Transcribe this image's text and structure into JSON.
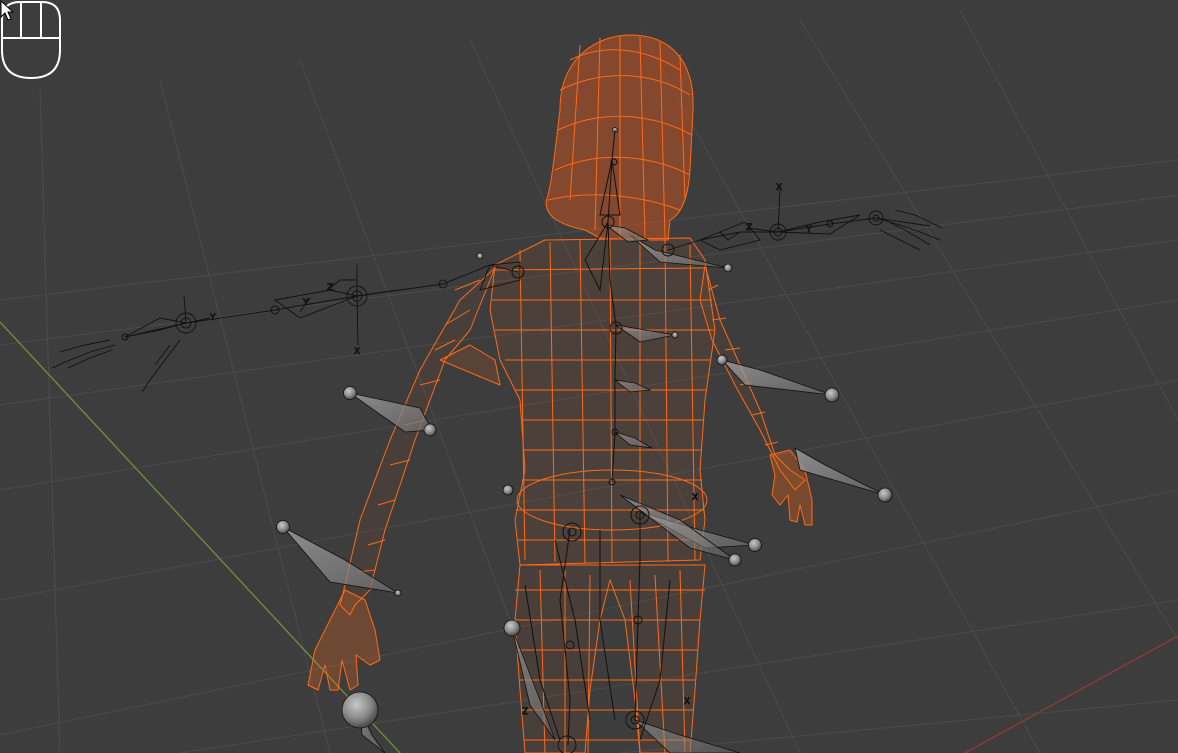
{
  "viewport": {
    "background_color": "#3d3d3d",
    "grid_color": "#4a4a4a",
    "x_axis_color": "#8a3a3a",
    "y_axis_color": "#6e8c3a",
    "selection_color": "#ff6a14",
    "bone_color": "#8c8c8c",
    "armature_line_color": "#111111"
  },
  "gizmo_axis_labels": {
    "x": "X",
    "y": "Y",
    "z": "Z"
  },
  "icons": {
    "mouse_indicator": "mouse-icon",
    "cursor": "arrow-cursor-icon"
  }
}
